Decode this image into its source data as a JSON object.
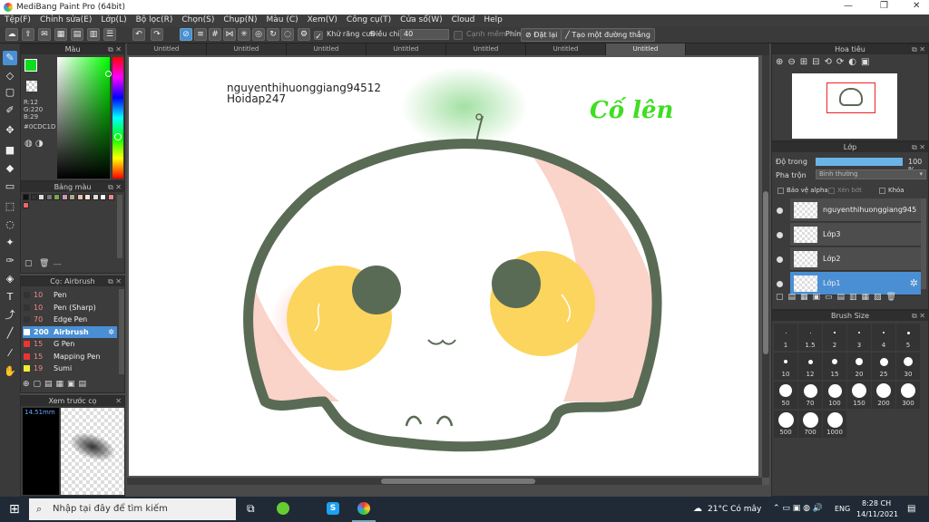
{
  "window": {
    "title": "MediBang Paint Pro (64bit)",
    "min": "—",
    "max": "❐",
    "close": "✕"
  },
  "menu": [
    "Tệp(F)",
    "Chỉnh sửa(E)",
    "Lớp(L)",
    "Bộ lọc(R)",
    "Chọn(S)",
    "Chụp(N)",
    "Màu (C)",
    "Xem(V)",
    "Công cụ(T)",
    "Cửa sổ(W)",
    "Cloud",
    "Help"
  ],
  "toolbar": {
    "antialias": "Khử răng cưa",
    "correction_label": "Điều chỉnh",
    "correction_value": "40",
    "soft_edge": "Cạnh mềm",
    "key_label": "Phím",
    "reset": "Đặt lại",
    "straight_line": "Tạo một đường thẳng"
  },
  "color_panel": {
    "title": "Màu",
    "r": "R:12",
    "g": "G:220",
    "b": "B:29",
    "hex": "#0CDC1D",
    "fg": "#0CDC1D",
    "bg": "#000000"
  },
  "palette_panel": {
    "title": "Bảng màu",
    "colors": [
      "#111111",
      "#333333",
      "#ddd",
      "#777",
      "#7a5",
      "#c9b",
      "#aa8",
      "#e8c0b0",
      "#fbe0d8",
      "#ddd",
      "#fff",
      "#e88",
      "#e66"
    ],
    "footer": "---"
  },
  "brush_panel": {
    "title": "Cọ: Airbrush",
    "items": [
      {
        "size": "10",
        "name": "Pen",
        "color": "#333"
      },
      {
        "size": "10",
        "name": "Pen (Sharp)",
        "color": "#333"
      },
      {
        "size": "70",
        "name": "Edge Pen",
        "color": "#333"
      },
      {
        "size": "200",
        "name": "Airbrush",
        "color": "#fff"
      },
      {
        "size": "15",
        "name": "G Pen",
        "color": "#e33"
      },
      {
        "size": "15",
        "name": "Mapping Pen",
        "color": "#e33"
      },
      {
        "size": "19",
        "name": "Sumi",
        "color": "#ee3"
      }
    ]
  },
  "preview_panel": {
    "title": "Xem trước cọ",
    "size": "14.51mm"
  },
  "tabs": [
    "Untitled",
    "Untitled",
    "Untitled",
    "Untitled",
    "Untitled",
    "Untitled",
    "Untitled"
  ],
  "canvas": {
    "username": "nguyenthihuonggiang94512",
    "site": "Hoidap247",
    "slogan": "Cố lên"
  },
  "nav_panel": {
    "title": "Hoa tiêu"
  },
  "layer_panel": {
    "title": "Lớp",
    "opacity_label": "Độ trong",
    "opacity_value": "100 %",
    "blend_label": "Pha trộn",
    "blend_value": "Bình thường",
    "protect_alpha": "Bảo vệ alpha",
    "clipping": "Xén bớt",
    "lock": "Khóa",
    "layers": [
      {
        "name": "nguyenthihuonggiang94512"
      },
      {
        "name": "Lớp3"
      },
      {
        "name": "Lớp2"
      },
      {
        "name": "Lớp1"
      }
    ]
  },
  "brush_size_panel": {
    "title": "Brush Size",
    "sizes": [
      "1",
      "1.5",
      "2",
      "3",
      "4",
      "5",
      "10",
      "12",
      "15",
      "20",
      "25",
      "30",
      "50",
      "70",
      "100",
      "150",
      "200",
      "300",
      "500",
      "700",
      "1000"
    ]
  },
  "taskbar": {
    "search": "Nhập tại đây để tìm kiếm",
    "weather": "21°C Có mây",
    "lang": "ENG",
    "time": "8:28 CH",
    "date": "14/11/2021"
  }
}
